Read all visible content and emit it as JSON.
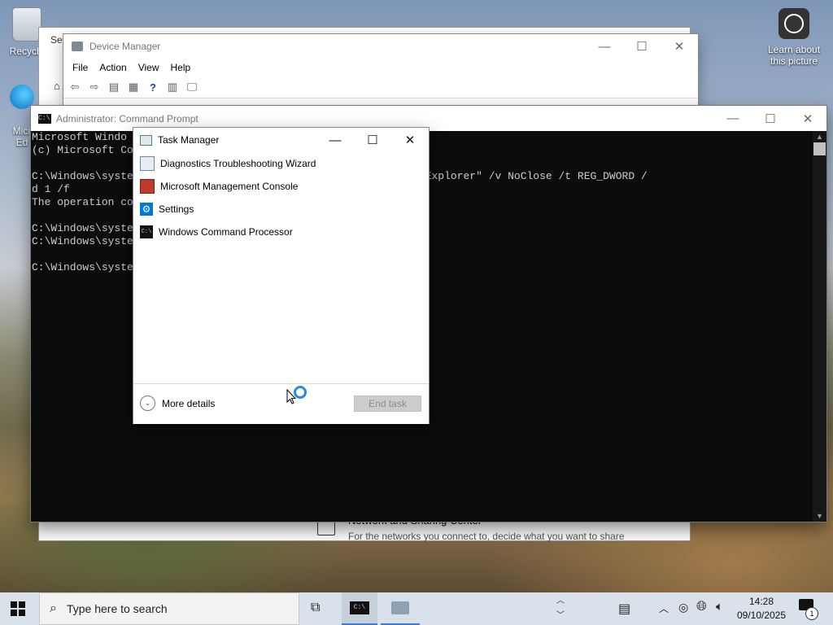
{
  "desktop": {
    "icons": [
      {
        "label": "Recycle",
        "icon": "recycle-bin-icon"
      },
      {
        "label": "Micr",
        "label2": "Ed",
        "icon": "edge-icon"
      }
    ],
    "learn": {
      "line1": "Learn about",
      "line2": "this picture",
      "icon": "camera-icon"
    }
  },
  "settings": {
    "title": "Set",
    "network_title": "Network and Sharing Center",
    "network_desc": "For the networks you connect to, decide what you want to share"
  },
  "device_manager": {
    "title": "Device Manager",
    "menu": [
      "File",
      "Action",
      "View",
      "Help"
    ]
  },
  "cmd": {
    "title": "Administrator: Command Prompt",
    "lines": [
      "Microsoft Windo",
      "(c) Microsoft Co",
      "",
      "C:\\Windows\\syste                      CurrentVersion\\Policies\\Explorer\" /v NoClose /t REG_DWORD /",
      "d 1 /f",
      "The operation co",
      "",
      "C:\\Windows\\syste",
      "C:\\Windows\\syste",
      "",
      "C:\\Windows\\syste"
    ]
  },
  "task_manager": {
    "title": "Task Manager",
    "items": [
      {
        "label": "Diagnostics Troubleshooting Wizard",
        "icon": "diagnostics-icon"
      },
      {
        "label": "Microsoft Management Console",
        "icon": "mmc-icon"
      },
      {
        "label": "Settings",
        "icon": "gear-icon"
      },
      {
        "label": "Windows Command Processor",
        "icon": "cmd-icon"
      }
    ],
    "more_details": "More details",
    "end_task": "End task"
  },
  "taskbar": {
    "search_placeholder": "Type here to search",
    "time": "14:28",
    "date": "09/10/2025",
    "notification_count": "1"
  },
  "colors": {
    "accent": "#0078d7",
    "cmd_bg": "#0c0c0c",
    "cmd_text": "#cccccc"
  }
}
